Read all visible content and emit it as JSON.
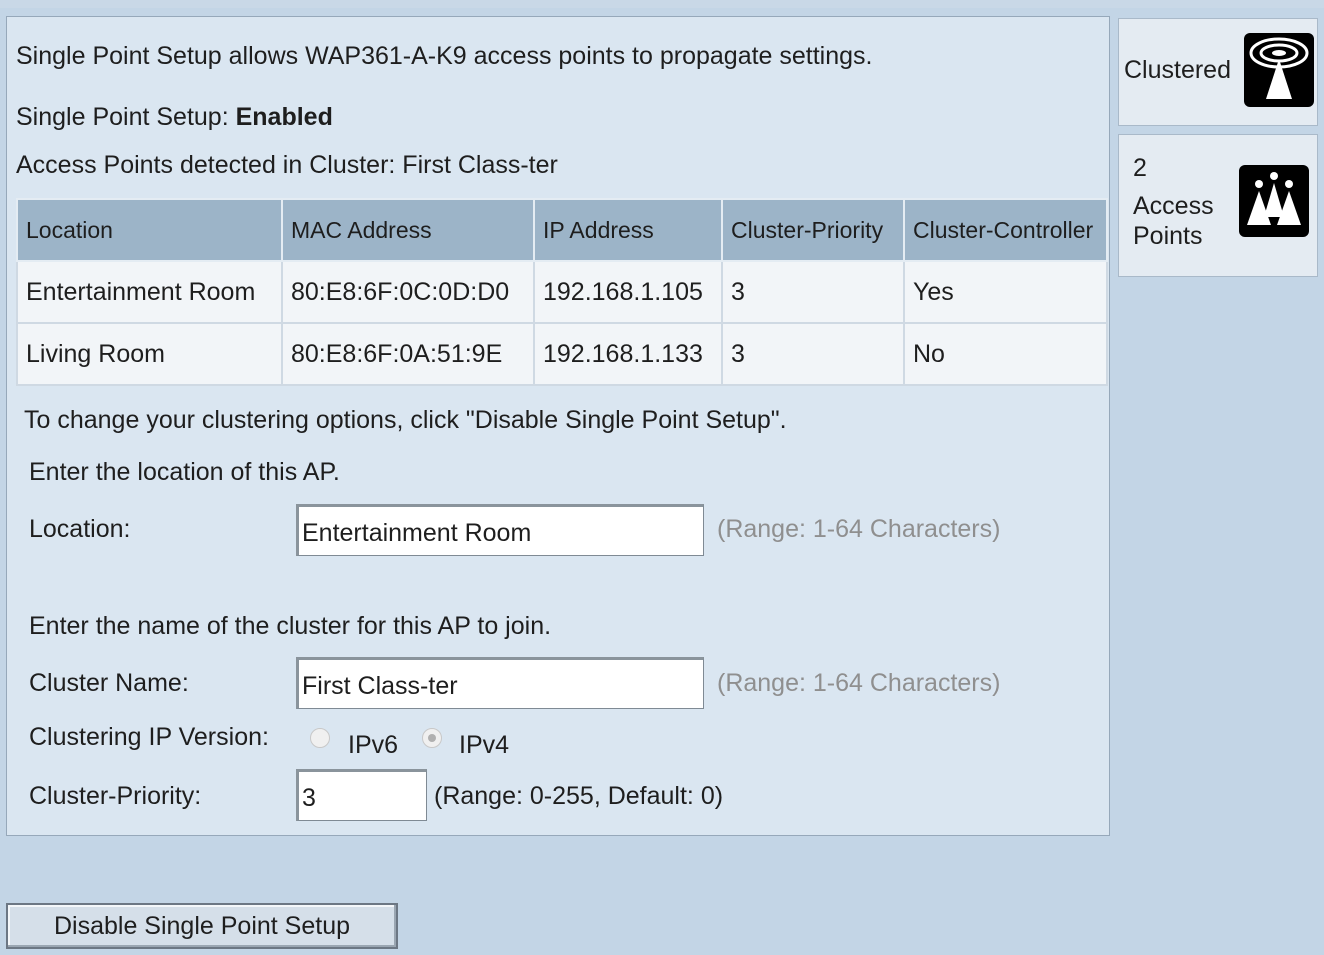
{
  "intro": {
    "description": "Single Point Setup allows WAP361-A-K9 access points to propagate settings.",
    "status_label": "Single Point Setup:",
    "status_value": "Enabled",
    "detected_label": "Access Points detected in Cluster: First Class-ter"
  },
  "table": {
    "headers": [
      "Location",
      "MAC Address",
      "IP Address",
      "Cluster-Priority",
      "Cluster-Controller"
    ],
    "rows": [
      [
        "Entertainment Room",
        "80:E8:6F:0C:0D:D0",
        "192.168.1.105",
        "3",
        "Yes"
      ],
      [
        "Living Room",
        "80:E8:6F:0A:51:9E",
        "192.168.1.133",
        "3",
        "No"
      ]
    ]
  },
  "form": {
    "change_note": "To change your clustering options, click \"Disable Single Point Setup\".",
    "location_prompt": "Enter the location of this AP.",
    "location_label": "Location:",
    "location_value": "Entertainment Room",
    "location_hint": "(Range: 1-64 Characters)",
    "cluster_prompt": "Enter the name of the cluster for this AP to join.",
    "cluster_name_label": "Cluster Name:",
    "cluster_name_value": "First Class-ter",
    "cluster_name_hint": "(Range: 1-64 Characters)",
    "ip_version_label": "Clustering IP Version:",
    "ip_version_options": [
      "IPv6",
      "IPv4"
    ],
    "ip_version_selected": "IPv4",
    "priority_label": "Cluster-Priority:",
    "priority_value": "3",
    "priority_hint": "(Range: 0-255, Default: 0)"
  },
  "sidebar": {
    "clustered_label": "Clustered",
    "clustered_icon": "cluster-antenna-icon",
    "ap_count": "2",
    "ap_label_line1": "Access",
    "ap_label_line2": "Points",
    "ap_icon": "access-points-icon"
  },
  "buttons": {
    "disable_label": "Disable Single Point Setup"
  }
}
